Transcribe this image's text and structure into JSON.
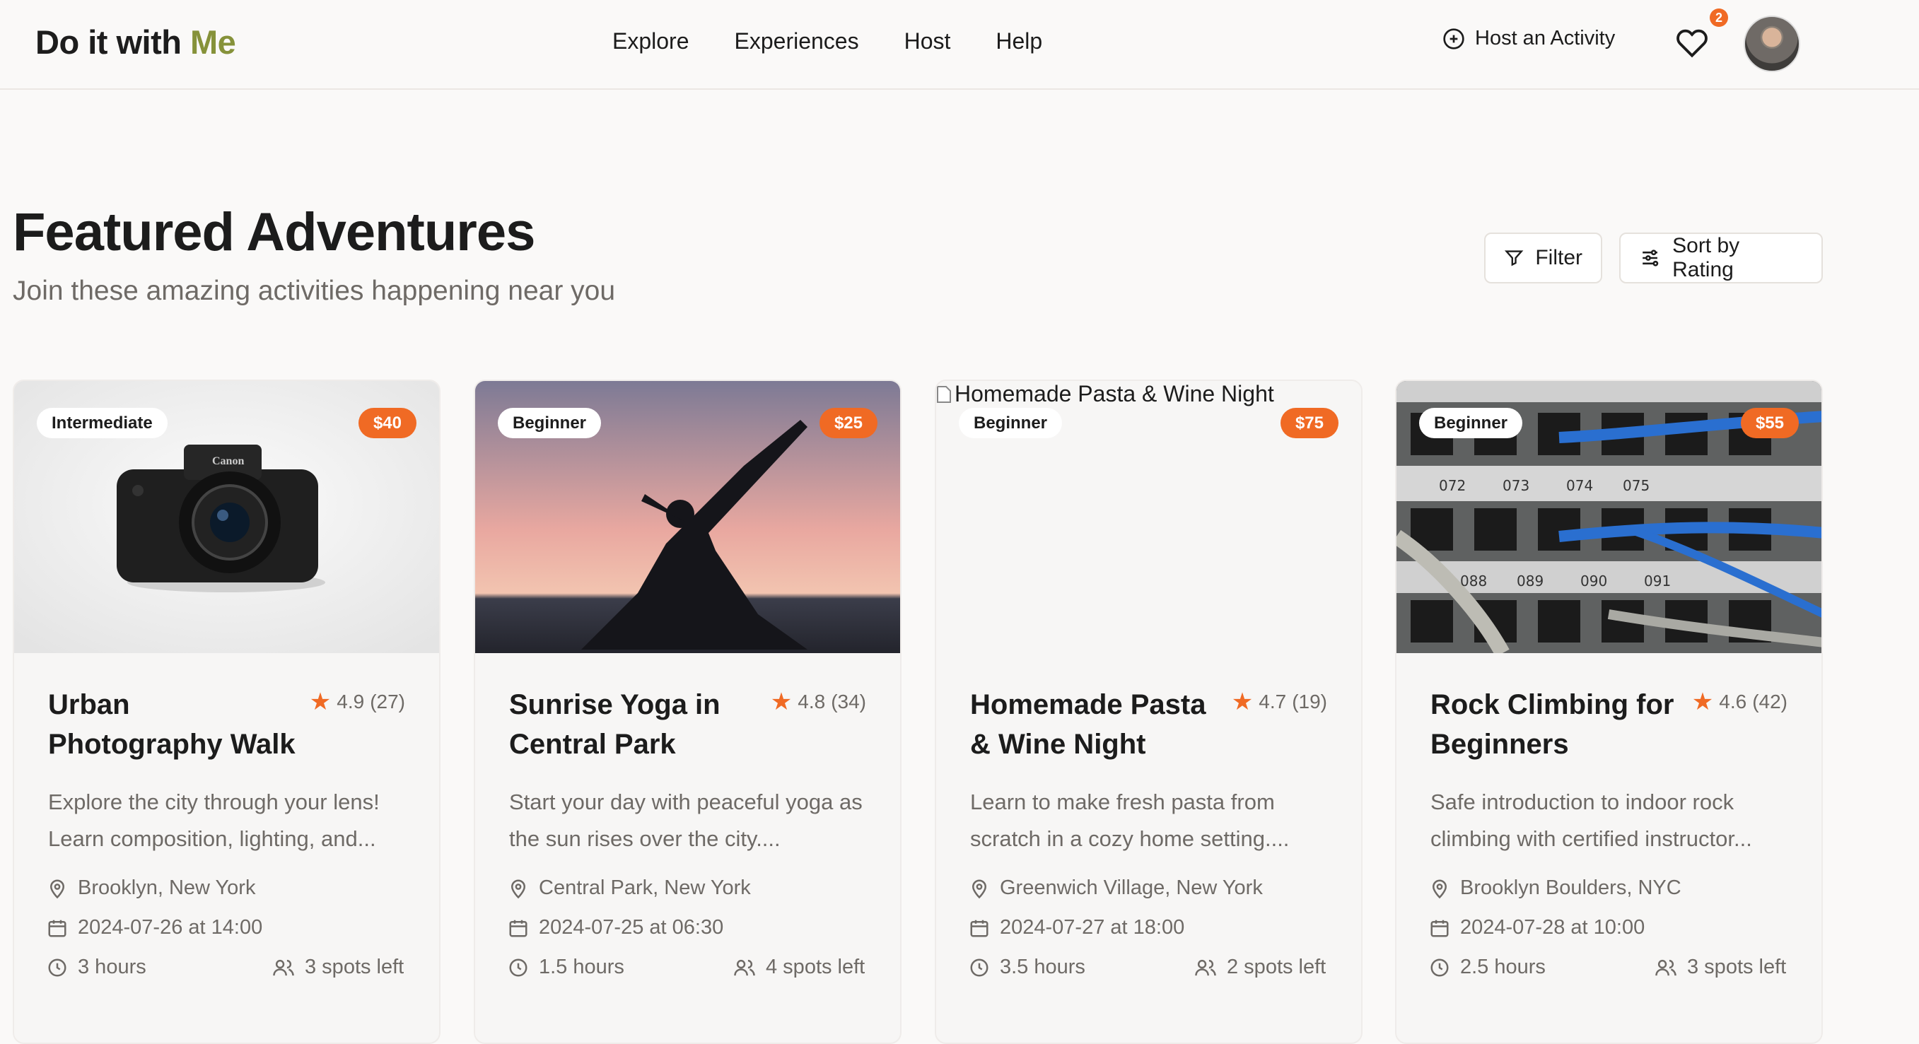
{
  "header": {
    "logo_main": "Do it with ",
    "logo_accent": "Me",
    "nav": [
      "Explore",
      "Experiences",
      "Host",
      "Help"
    ],
    "host_activity": "Host an Activity",
    "notification_count": "2"
  },
  "section": {
    "title": "Featured Adventures",
    "subtitle": "Join these amazing activities happening near you",
    "filter_label": "Filter",
    "sort_label": "Sort by Rating"
  },
  "colors": {
    "accent": "#f06a24",
    "logo_accent": "#86923a",
    "background": "#faf9f8"
  },
  "cards": [
    {
      "level": "Intermediate",
      "price": "$40",
      "title": "Urban Photography Walk",
      "rating": "4.9",
      "reviews": "(27)",
      "description": "Explore the city through your lens! Learn composition, lighting, and...",
      "location": "Brooklyn, New York",
      "datetime": "2024-07-26 at 14:00",
      "duration": "3 hours",
      "spots": "3 spots left",
      "image": "camera-photo"
    },
    {
      "level": "Beginner",
      "price": "$25",
      "title": "Sunrise Yoga in Central Park",
      "rating": "4.8",
      "reviews": "(34)",
      "description": "Start your day with peaceful yoga as the sun rises over the city....",
      "location": "Central Park, New York",
      "datetime": "2024-07-25 at 06:30",
      "duration": "1.5 hours",
      "spots": "4 spots left",
      "image": "yoga-sunset-photo"
    },
    {
      "level": "Beginner",
      "price": "$75",
      "title": "Homemade Pasta & Wine Night",
      "rating": "4.7",
      "reviews": "(19)",
      "description": "Learn to make fresh pasta from scratch in a cozy home setting....",
      "location": "Greenwich Village, New York",
      "datetime": "2024-07-27 at 18:00",
      "duration": "3.5 hours",
      "spots": "2 spots left",
      "image": "broken-image",
      "image_alt": "Homemade Pasta & Wine Night"
    },
    {
      "level": "Beginner",
      "price": "$55",
      "title": "Rock Climbing for Beginners",
      "rating": "4.6",
      "reviews": "(42)",
      "description": "Safe introduction to indoor rock climbing with certified instructor...",
      "location": "Brooklyn Boulders, NYC",
      "datetime": "2024-07-28 at 10:00",
      "duration": "2.5 hours",
      "spots": "3 spots left",
      "image": "network-cables-photo"
    }
  ]
}
